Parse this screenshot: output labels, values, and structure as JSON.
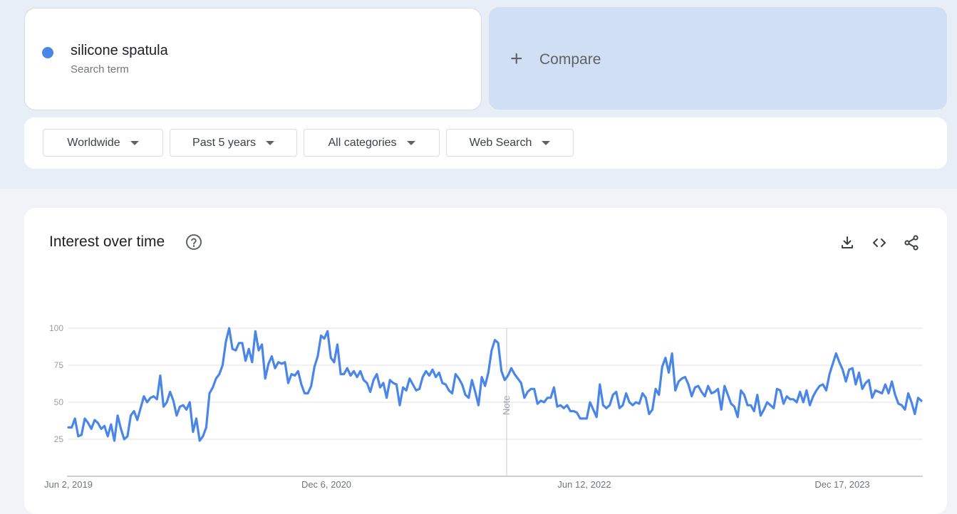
{
  "search_term": {
    "name": "silicone spatula",
    "subtitle": "Search term",
    "color": "#4a86e8"
  },
  "compare": {
    "plus": "+",
    "label": "Compare"
  },
  "filters": [
    {
      "label": "Worldwide"
    },
    {
      "label": "Past 5 years"
    },
    {
      "label": "All categories"
    },
    {
      "label": "Web Search"
    }
  ],
  "panel": {
    "title": "Interest over time"
  },
  "icons": {
    "help": "help-circle-icon",
    "download": "download-icon",
    "embed": "code-icon",
    "share": "share-icon"
  },
  "note_label": "Note",
  "chart_data": {
    "type": "line",
    "x_labels": [
      "Jun 2, 2019",
      "Dec 6, 2020",
      "Jun 12, 2022",
      "Dec 17, 2023"
    ],
    "y_ticks": [
      25,
      50,
      75,
      100
    ],
    "ylim": [
      0,
      100
    ],
    "grid": true,
    "line_color": "#4a86e8",
    "series": [
      {
        "values": [
          33,
          33,
          39,
          27,
          28,
          39,
          36,
          32,
          38,
          36,
          32,
          34,
          27,
          35,
          24,
          41,
          32,
          25,
          27,
          41,
          44,
          38,
          46,
          54,
          50,
          53,
          54,
          52,
          68,
          47,
          50,
          57,
          51,
          41,
          47,
          48,
          45,
          50,
          30,
          39,
          24,
          27,
          33,
          56,
          60,
          66,
          69,
          75,
          91,
          100,
          86,
          85,
          90,
          90,
          78,
          86,
          77,
          98,
          85,
          89,
          66,
          76,
          81,
          73,
          77,
          76,
          77,
          63,
          69,
          68,
          71,
          62,
          56,
          56,
          61,
          74,
          81,
          95,
          93,
          98,
          80,
          77,
          89,
          69,
          69,
          73,
          68,
          71,
          67,
          71,
          65,
          63,
          57,
          65,
          69,
          60,
          63,
          53,
          65,
          63,
          62,
          48,
          60,
          58,
          66,
          62,
          58,
          59,
          67,
          71,
          68,
          72,
          67,
          70,
          63,
          62,
          58,
          56,
          69,
          66,
          62,
          55,
          53,
          65,
          57,
          48,
          67,
          61,
          70,
          85,
          92,
          90,
          71,
          65,
          68,
          73,
          69,
          66,
          63,
          53,
          57,
          59,
          59,
          49,
          51,
          50,
          53,
          53,
          60,
          47,
          48,
          46,
          48,
          44,
          44,
          43,
          39,
          39,
          39,
          50,
          45,
          40,
          62,
          48,
          46,
          48,
          55,
          57,
          46,
          48,
          56,
          50,
          48,
          50,
          49,
          56,
          53,
          42,
          45,
          59,
          55,
          74,
          80,
          70,
          83,
          58,
          64,
          66,
          67,
          62,
          54,
          60,
          61,
          57,
          54,
          61,
          56,
          57,
          59,
          45,
          61,
          55,
          49,
          47,
          40,
          58,
          55,
          48,
          48,
          44,
          55,
          41,
          45,
          50,
          48,
          46,
          59,
          58,
          49,
          54,
          52,
          52,
          50,
          57,
          50,
          58,
          48,
          54,
          58,
          61,
          62,
          58,
          69,
          76,
          83,
          77,
          72,
          64,
          72,
          73,
          62,
          70,
          59,
          63,
          65,
          53,
          58,
          57,
          56,
          62,
          56,
          64,
          55,
          49,
          48,
          45,
          56,
          50,
          42,
          53,
          51
        ]
      }
    ]
  }
}
